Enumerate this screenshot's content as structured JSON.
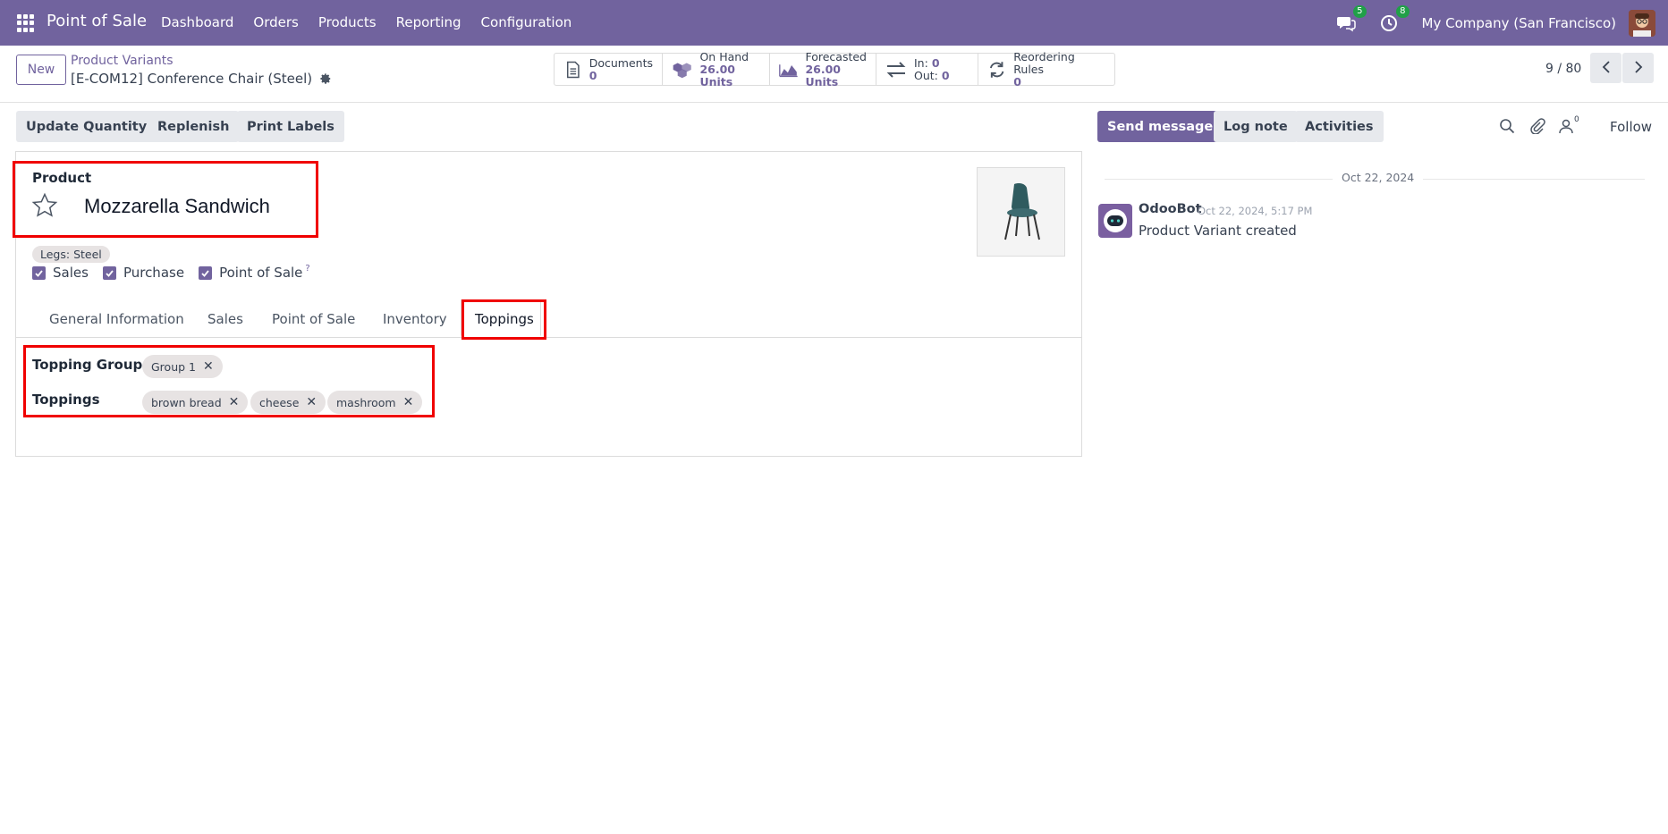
{
  "navbar": {
    "app_name": "Point of Sale",
    "menu": [
      "Dashboard",
      "Orders",
      "Products",
      "Reporting",
      "Configuration"
    ],
    "messages_badge": "5",
    "activities_badge": "8",
    "company": "My Company (San Francisco)"
  },
  "control": {
    "new_label": "New",
    "breadcrumb": "Product Variants",
    "record_title": "[E-COM12] Conference Chair (Steel)",
    "pager": "9 / 80"
  },
  "stats": {
    "documents_label": "Documents",
    "documents_value": "0",
    "onhand_label": "On Hand",
    "onhand_value": "26.00 Units",
    "forecasted_label": "Forecasted",
    "forecasted_value": "26.00 Units",
    "in_label": "In:",
    "in_value": "0",
    "out_label": "Out:",
    "out_value": "0",
    "reordering_label": "Reordering Rules",
    "reordering_value": "0"
  },
  "actions": {
    "update_quantity": "Update Quantity",
    "replenish": "Replenish",
    "print_labels": "Print Labels"
  },
  "form": {
    "product_label": "Product",
    "product_name": "Mozzarella Sandwich",
    "attribute_tag": "Legs: Steel",
    "checks": {
      "sales": "Sales",
      "purchase": "Purchase",
      "pos": "Point of Sale",
      "help": "?"
    },
    "tabs": {
      "general": "General Information",
      "sales": "Sales",
      "pos": "Point of Sale",
      "inventory": "Inventory",
      "toppings": "Toppings"
    },
    "topping_group_label": "Topping Group",
    "topping_group_tags": [
      "Group 1"
    ],
    "toppings_label": "Toppings",
    "toppings_tags": [
      "brown bread",
      "cheese",
      "mashroom"
    ],
    "tag_remove": "✕"
  },
  "chatter": {
    "send_message": "Send message",
    "log_note": "Log note",
    "activities": "Activities",
    "followers_count": "0",
    "follow": "Follow",
    "date_separator": "Oct 22, 2024",
    "message": {
      "author": "OdooBot",
      "date": "Oct 22, 2024, 5:17 PM",
      "body": "Product Variant created"
    }
  },
  "colors": {
    "brand": "#71639e",
    "highlight": "#f00000",
    "badge": "#20a048"
  }
}
